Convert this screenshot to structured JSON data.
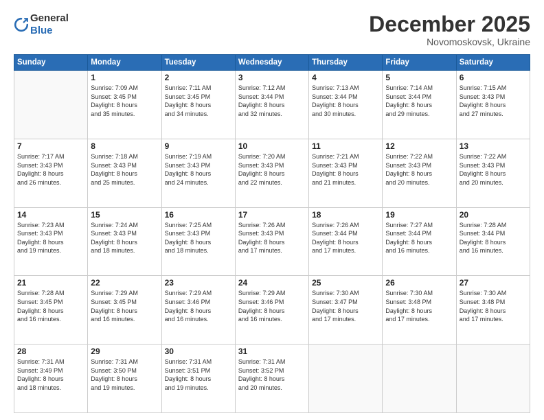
{
  "header": {
    "logo_general": "General",
    "logo_blue": "Blue",
    "month": "December 2025",
    "location": "Novomoskovsk, Ukraine"
  },
  "weekdays": [
    "Sunday",
    "Monday",
    "Tuesday",
    "Wednesday",
    "Thursday",
    "Friday",
    "Saturday"
  ],
  "weeks": [
    [
      {
        "day": "",
        "sunrise": "",
        "sunset": "",
        "daylight": ""
      },
      {
        "day": "1",
        "sunrise": "Sunrise: 7:09 AM",
        "sunset": "Sunset: 3:45 PM",
        "daylight": "Daylight: 8 hours and 35 minutes."
      },
      {
        "day": "2",
        "sunrise": "Sunrise: 7:11 AM",
        "sunset": "Sunset: 3:45 PM",
        "daylight": "Daylight: 8 hours and 34 minutes."
      },
      {
        "day": "3",
        "sunrise": "Sunrise: 7:12 AM",
        "sunset": "Sunset: 3:44 PM",
        "daylight": "Daylight: 8 hours and 32 minutes."
      },
      {
        "day": "4",
        "sunrise": "Sunrise: 7:13 AM",
        "sunset": "Sunset: 3:44 PM",
        "daylight": "Daylight: 8 hours and 30 minutes."
      },
      {
        "day": "5",
        "sunrise": "Sunrise: 7:14 AM",
        "sunset": "Sunset: 3:44 PM",
        "daylight": "Daylight: 8 hours and 29 minutes."
      },
      {
        "day": "6",
        "sunrise": "Sunrise: 7:15 AM",
        "sunset": "Sunset: 3:43 PM",
        "daylight": "Daylight: 8 hours and 27 minutes."
      }
    ],
    [
      {
        "day": "7",
        "sunrise": "Sunrise: 7:17 AM",
        "sunset": "Sunset: 3:43 PM",
        "daylight": "Daylight: 8 hours and 26 minutes."
      },
      {
        "day": "8",
        "sunrise": "Sunrise: 7:18 AM",
        "sunset": "Sunset: 3:43 PM",
        "daylight": "Daylight: 8 hours and 25 minutes."
      },
      {
        "day": "9",
        "sunrise": "Sunrise: 7:19 AM",
        "sunset": "Sunset: 3:43 PM",
        "daylight": "Daylight: 8 hours and 24 minutes."
      },
      {
        "day": "10",
        "sunrise": "Sunrise: 7:20 AM",
        "sunset": "Sunset: 3:43 PM",
        "daylight": "Daylight: 8 hours and 22 minutes."
      },
      {
        "day": "11",
        "sunrise": "Sunrise: 7:21 AM",
        "sunset": "Sunset: 3:43 PM",
        "daylight": "Daylight: 8 hours and 21 minutes."
      },
      {
        "day": "12",
        "sunrise": "Sunrise: 7:22 AM",
        "sunset": "Sunset: 3:43 PM",
        "daylight": "Daylight: 8 hours and 20 minutes."
      },
      {
        "day": "13",
        "sunrise": "Sunrise: 7:22 AM",
        "sunset": "Sunset: 3:43 PM",
        "daylight": "Daylight: 8 hours and 20 minutes."
      }
    ],
    [
      {
        "day": "14",
        "sunrise": "Sunrise: 7:23 AM",
        "sunset": "Sunset: 3:43 PM",
        "daylight": "Daylight: 8 hours and 19 minutes."
      },
      {
        "day": "15",
        "sunrise": "Sunrise: 7:24 AM",
        "sunset": "Sunset: 3:43 PM",
        "daylight": "Daylight: 8 hours and 18 minutes."
      },
      {
        "day": "16",
        "sunrise": "Sunrise: 7:25 AM",
        "sunset": "Sunset: 3:43 PM",
        "daylight": "Daylight: 8 hours and 18 minutes."
      },
      {
        "day": "17",
        "sunrise": "Sunrise: 7:26 AM",
        "sunset": "Sunset: 3:43 PM",
        "daylight": "Daylight: 8 hours and 17 minutes."
      },
      {
        "day": "18",
        "sunrise": "Sunrise: 7:26 AM",
        "sunset": "Sunset: 3:44 PM",
        "daylight": "Daylight: 8 hours and 17 minutes."
      },
      {
        "day": "19",
        "sunrise": "Sunrise: 7:27 AM",
        "sunset": "Sunset: 3:44 PM",
        "daylight": "Daylight: 8 hours and 16 minutes."
      },
      {
        "day": "20",
        "sunrise": "Sunrise: 7:28 AM",
        "sunset": "Sunset: 3:44 PM",
        "daylight": "Daylight: 8 hours and 16 minutes."
      }
    ],
    [
      {
        "day": "21",
        "sunrise": "Sunrise: 7:28 AM",
        "sunset": "Sunset: 3:45 PM",
        "daylight": "Daylight: 8 hours and 16 minutes."
      },
      {
        "day": "22",
        "sunrise": "Sunrise: 7:29 AM",
        "sunset": "Sunset: 3:45 PM",
        "daylight": "Daylight: 8 hours and 16 minutes."
      },
      {
        "day": "23",
        "sunrise": "Sunrise: 7:29 AM",
        "sunset": "Sunset: 3:46 PM",
        "daylight": "Daylight: 8 hours and 16 minutes."
      },
      {
        "day": "24",
        "sunrise": "Sunrise: 7:29 AM",
        "sunset": "Sunset: 3:46 PM",
        "daylight": "Daylight: 8 hours and 16 minutes."
      },
      {
        "day": "25",
        "sunrise": "Sunrise: 7:30 AM",
        "sunset": "Sunset: 3:47 PM",
        "daylight": "Daylight: 8 hours and 17 minutes."
      },
      {
        "day": "26",
        "sunrise": "Sunrise: 7:30 AM",
        "sunset": "Sunset: 3:48 PM",
        "daylight": "Daylight: 8 hours and 17 minutes."
      },
      {
        "day": "27",
        "sunrise": "Sunrise: 7:30 AM",
        "sunset": "Sunset: 3:48 PM",
        "daylight": "Daylight: 8 hours and 17 minutes."
      }
    ],
    [
      {
        "day": "28",
        "sunrise": "Sunrise: 7:31 AM",
        "sunset": "Sunset: 3:49 PM",
        "daylight": "Daylight: 8 hours and 18 minutes."
      },
      {
        "day": "29",
        "sunrise": "Sunrise: 7:31 AM",
        "sunset": "Sunset: 3:50 PM",
        "daylight": "Daylight: 8 hours and 19 minutes."
      },
      {
        "day": "30",
        "sunrise": "Sunrise: 7:31 AM",
        "sunset": "Sunset: 3:51 PM",
        "daylight": "Daylight: 8 hours and 19 minutes."
      },
      {
        "day": "31",
        "sunrise": "Sunrise: 7:31 AM",
        "sunset": "Sunset: 3:52 PM",
        "daylight": "Daylight: 8 hours and 20 minutes."
      },
      {
        "day": "",
        "sunrise": "",
        "sunset": "",
        "daylight": ""
      },
      {
        "day": "",
        "sunrise": "",
        "sunset": "",
        "daylight": ""
      },
      {
        "day": "",
        "sunrise": "",
        "sunset": "",
        "daylight": ""
      }
    ]
  ]
}
